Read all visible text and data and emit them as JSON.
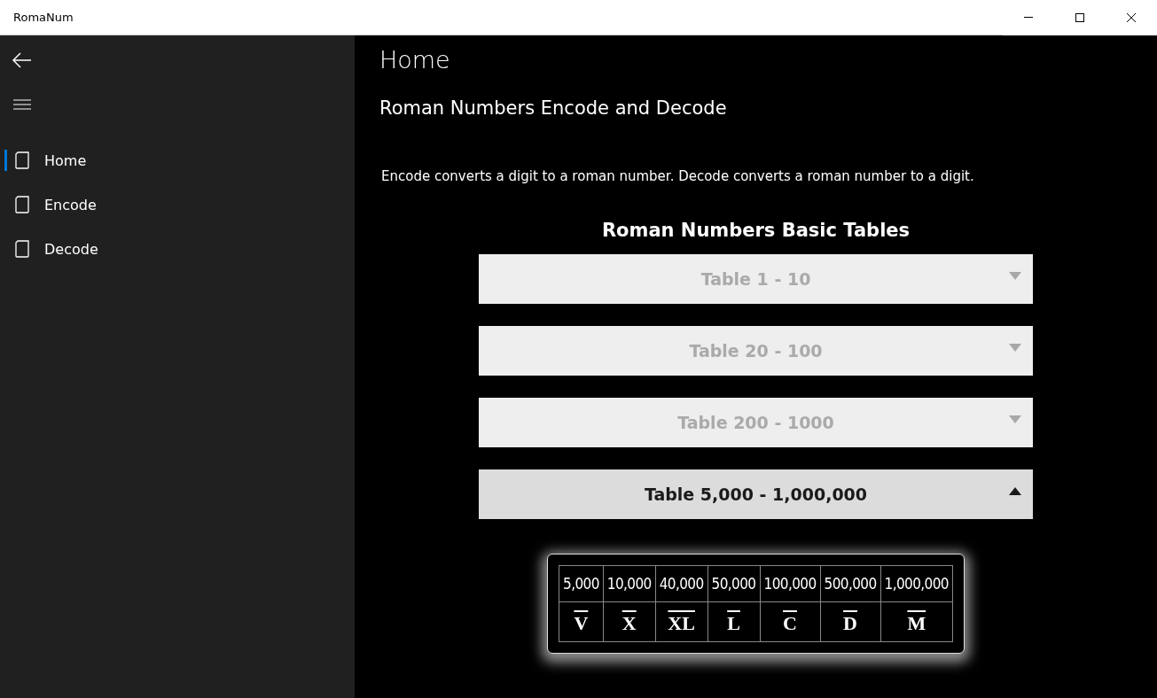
{
  "window": {
    "title": "RomaNum"
  },
  "sidebar": {
    "items": [
      {
        "label": "Home",
        "selected": true
      },
      {
        "label": "Encode",
        "selected": false
      },
      {
        "label": "Decode",
        "selected": false
      }
    ]
  },
  "page": {
    "title": "Home",
    "subtitle": "Roman Numbers Encode and Decode",
    "description": "Encode converts a digit to a roman number. Decode converts a roman number to a digit.",
    "heading": "Roman Numbers Basic Tables"
  },
  "sections": [
    {
      "label": "Table 1 - 10",
      "expanded": false
    },
    {
      "label": "Table 20 - 100",
      "expanded": false
    },
    {
      "label": "Table 200 - 1000",
      "expanded": false
    },
    {
      "label": "Table 5,000 - 1,000,000",
      "expanded": true,
      "table": {
        "rows": [
          [
            "5,000",
            "10,000",
            "40,000",
            "50,000",
            "100,000",
            "500,000",
            "1,000,000"
          ],
          [
            "V",
            "X",
            "XL",
            "L",
            "C",
            "D",
            "M"
          ]
        ]
      }
    }
  ]
}
